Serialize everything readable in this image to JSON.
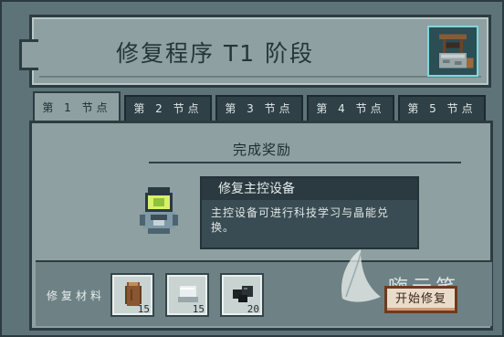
{
  "window": {
    "title": "修复程序 T1 阶段"
  },
  "tabs": [
    {
      "label": "第 1 节点",
      "active": true
    },
    {
      "label": "第 2 节点",
      "active": false
    },
    {
      "label": "第 3 节点",
      "active": false
    },
    {
      "label": "第 4 节点",
      "active": false
    },
    {
      "label": "第 5 节点",
      "active": false
    }
  ],
  "reward": {
    "title": "完成奖励",
    "name": "修复主控设备",
    "description": "主控设备可进行科技学习与晶能兑换。"
  },
  "materials": {
    "label": "修复材料",
    "items": [
      {
        "icon": "wood-log-icon",
        "count": "15"
      },
      {
        "icon": "metal-plate-icon",
        "count": "15"
      },
      {
        "icon": "coal-icon",
        "count": "20"
      }
    ]
  },
  "watermark": {
    "text": "嗨云笑"
  },
  "actions": {
    "start_repair": "开始修复"
  },
  "colors": {
    "panel": "#8ea0a1",
    "dark": "#2f4047",
    "button": "#eadccb",
    "button_border": "#6e3a20"
  }
}
